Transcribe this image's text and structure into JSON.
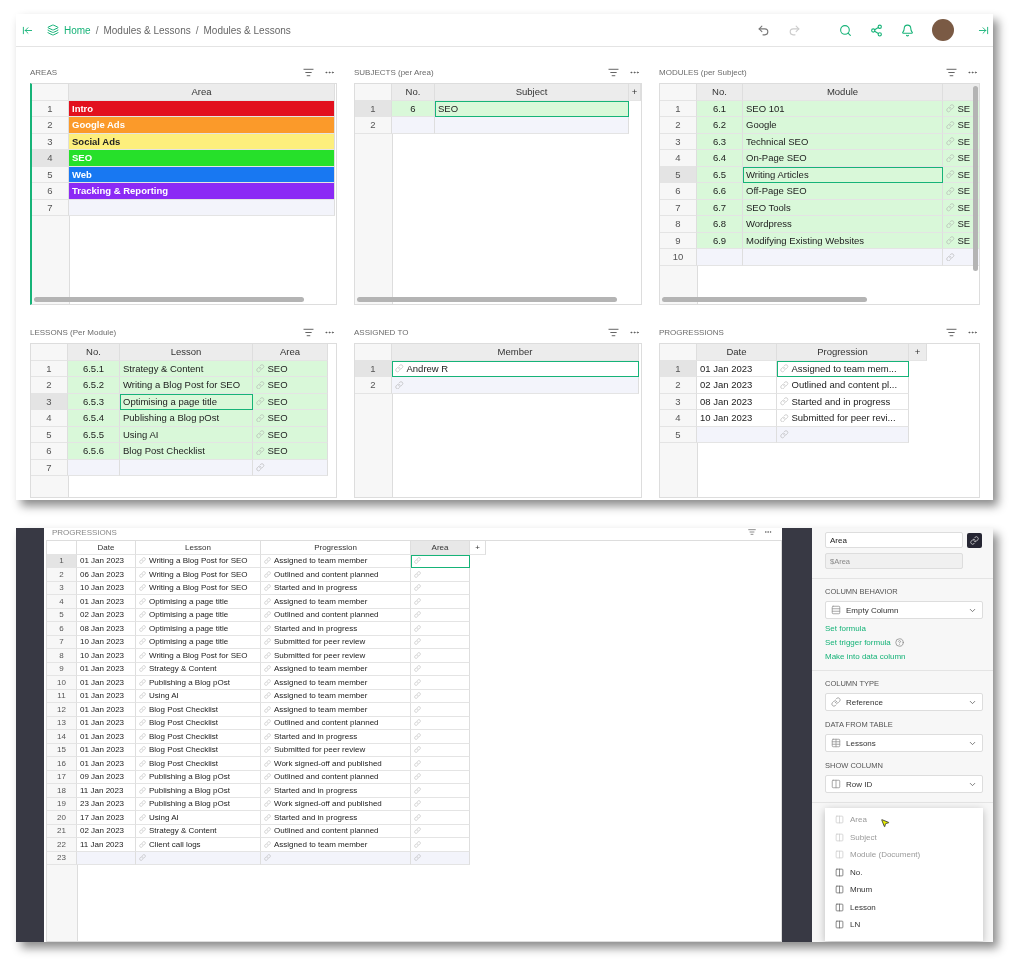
{
  "breadcrumb": {
    "items": [
      "Home",
      "Modules & Lessons",
      "Modules & Lessons"
    ],
    "separator": "/"
  },
  "widgets": [
    {
      "title": "AREAS",
      "active": true,
      "columns": [
        {
          "label": "Area",
          "kind": "text",
          "cursor": false
        }
      ],
      "rows": [
        {
          "num": "1",
          "cells": [
            "Intro"
          ],
          "color": "#e2101e",
          "selected": false
        },
        {
          "num": "2",
          "cells": [
            "Google Ads"
          ],
          "color": "#fb9a2a",
          "selected": false
        },
        {
          "num": "3",
          "cells": [
            "Social Ads"
          ],
          "color": "#fdef7c",
          "selected": false
        },
        {
          "num": "4",
          "cells": [
            "SEO"
          ],
          "color": "#26e02a",
          "selected": true
        },
        {
          "num": "5",
          "cells": [
            "Web"
          ],
          "color": "#1878f2",
          "selected": false
        },
        {
          "num": "6",
          "cells": [
            "Tracking & Reporting"
          ],
          "color": "#8b2af5",
          "selected": false
        }
      ],
      "new_row": "7"
    },
    {
      "title": "SUBJECTS (per Area)",
      "active": false,
      "add_label": "+",
      "columns": [
        {
          "label": "No.",
          "kind": "num",
          "cursor": false
        },
        {
          "label": "Subject",
          "kind": "text",
          "cursor": true
        }
      ],
      "rows": [
        {
          "num": "1",
          "cells": [
            "6",
            "SEO"
          ],
          "highlighted": true,
          "selected": true
        }
      ],
      "new_row": "2"
    },
    {
      "title": "MODULES (per Subject)",
      "active": false,
      "columns": [
        {
          "label": "No.",
          "kind": "num",
          "cursor": false
        },
        {
          "label": "Module",
          "kind": "text",
          "cursor": true
        },
        {
          "kind": "ref",
          "cursor": false
        }
      ],
      "rows": [
        {
          "num": "1",
          "cells": [
            "6.1",
            "SEO 101",
            "SE"
          ],
          "highlighted": true,
          "selected": false
        },
        {
          "num": "2",
          "cells": [
            "6.2",
            "Google",
            "SE"
          ],
          "highlighted": true,
          "selected": false
        },
        {
          "num": "3",
          "cells": [
            "6.3",
            "Technical SEO",
            "SE"
          ],
          "highlighted": true,
          "selected": false
        },
        {
          "num": "4",
          "cells": [
            "6.4",
            "On-Page SEO",
            "SE"
          ],
          "highlighted": true,
          "selected": false
        },
        {
          "num": "5",
          "cells": [
            "6.5",
            "Writing Articles",
            "SE"
          ],
          "highlighted": true,
          "selected": true
        },
        {
          "num": "6",
          "cells": [
            "6.6",
            "Off-Page SEO",
            "SE"
          ],
          "highlighted": true,
          "selected": false
        },
        {
          "num": "7",
          "cells": [
            "6.7",
            "SEO Tools",
            "SE"
          ],
          "highlighted": true,
          "selected": false
        },
        {
          "num": "8",
          "cells": [
            "6.8",
            "Wordpress",
            "SE"
          ],
          "highlighted": true,
          "selected": false
        },
        {
          "num": "9",
          "cells": [
            "6.9",
            "Modifying Existing Websites",
            "SE"
          ],
          "highlighted": true,
          "selected": false
        }
      ],
      "new_row": "10"
    },
    {
      "title": "LESSONS (Per Module)",
      "active": false,
      "columns": [
        {
          "label": "No.",
          "kind": "num",
          "cursor": false
        },
        {
          "label": "Lesson",
          "kind": "text",
          "cursor": true
        },
        {
          "label": "Area",
          "kind": "ref",
          "cursor": false
        }
      ],
      "rows": [
        {
          "num": "1",
          "cells": [
            "6.5.1",
            "Strategy & Content",
            "SEO"
          ],
          "highlighted": true,
          "selected": false
        },
        {
          "num": "2",
          "cells": [
            "6.5.2",
            "Writing a Blog Post for SEO",
            "SEO"
          ],
          "highlighted": true,
          "selected": false
        },
        {
          "num": "3",
          "cells": [
            "6.5.3",
            "Optimising a page title",
            "SEO"
          ],
          "highlighted": true,
          "selected": true
        },
        {
          "num": "4",
          "cells": [
            "6.5.4",
            "Publishing a Blog pOst",
            "SEO"
          ],
          "highlighted": true,
          "selected": false
        },
        {
          "num": "5",
          "cells": [
            "6.5.5",
            "Using AI",
            "SEO"
          ],
          "highlighted": true,
          "selected": false
        },
        {
          "num": "6",
          "cells": [
            "6.5.6",
            "Blog Post Checklist",
            "SEO"
          ],
          "highlighted": true,
          "selected": false
        }
      ],
      "new_row": "7"
    },
    {
      "title": "ASSIGNED TO",
      "active": false,
      "columns": [
        {
          "label": "Member",
          "kind": "ref",
          "cursor": true
        }
      ],
      "rows": [
        {
          "num": "1",
          "cells": [
            "Andrew R"
          ],
          "highlighted": false,
          "selected": true
        }
      ],
      "new_row": "2"
    },
    {
      "title": "PROGRESSIONS",
      "active": false,
      "add_label": "+",
      "columns": [
        {
          "label": "Date",
          "kind": "text",
          "cursor": false
        },
        {
          "label": "Progression",
          "kind": "ref",
          "cursor": true
        }
      ],
      "rows": [
        {
          "num": "1",
          "cells": [
            "01 Jan 2023",
            "Assigned to team mem..."
          ],
          "highlighted": false,
          "selected": true
        },
        {
          "num": "2",
          "cells": [
            "02 Jan 2023",
            "Outlined and content pl..."
          ],
          "highlighted": false,
          "selected": false
        },
        {
          "num": "3",
          "cells": [
            "08 Jan 2023",
            "Started and in progress"
          ],
          "highlighted": false,
          "selected": false
        },
        {
          "num": "4",
          "cells": [
            "10 Jan 2023",
            "Submitted for peer revi..."
          ],
          "highlighted": false,
          "selected": false
        }
      ],
      "new_row": "5"
    }
  ],
  "grid": {
    "title": "PROGRESSIONS",
    "add_label": "+",
    "columns": [
      {
        "label": "Date",
        "kind": "text",
        "selected": false,
        "cursor": false
      },
      {
        "label": "Lesson",
        "kind": "ref",
        "selected": false,
        "cursor": false
      },
      {
        "label": "Progression",
        "kind": "ref",
        "selected": false,
        "cursor": false
      },
      {
        "label": "Area",
        "kind": "ref",
        "selected": true,
        "cursor": true
      }
    ],
    "rows": [
      {
        "num": "1",
        "cells": [
          "01 Jan 2023",
          "Writing a Blog Post for SEO",
          "Assigned to team member",
          null
        ],
        "selected": true
      },
      {
        "num": "2",
        "cells": [
          "06 Jan 2023",
          "Writing a Blog Post for SEO",
          "Outlined and content planned",
          null
        ],
        "selected": false
      },
      {
        "num": "3",
        "cells": [
          "10 Jan 2023",
          "Writing a Blog Post for SEO",
          "Started and in progress",
          null
        ],
        "selected": false
      },
      {
        "num": "4",
        "cells": [
          "01 Jan 2023",
          "Optimising a page title",
          "Assigned to team member",
          null
        ],
        "selected": false
      },
      {
        "num": "5",
        "cells": [
          "02 Jan 2023",
          "Optimising a page title",
          "Outlined and content planned",
          null
        ],
        "selected": false
      },
      {
        "num": "6",
        "cells": [
          "08 Jan 2023",
          "Optimising a page title",
          "Started and in progress",
          null
        ],
        "selected": false
      },
      {
        "num": "7",
        "cells": [
          "10 Jan 2023",
          "Optimising a page title",
          "Submitted for peer review",
          null
        ],
        "selected": false
      },
      {
        "num": "8",
        "cells": [
          "10 Jan 2023",
          "Writing a Blog Post for SEO",
          "Submitted for peer review",
          null
        ],
        "selected": false
      },
      {
        "num": "9",
        "cells": [
          "01 Jan 2023",
          "Strategy & Content",
          "Assigned to team member",
          null
        ],
        "selected": false
      },
      {
        "num": "10",
        "cells": [
          "01 Jan 2023",
          "Publishing a Blog pOst",
          "Assigned to team member",
          null
        ],
        "selected": false
      },
      {
        "num": "11",
        "cells": [
          "01 Jan 2023",
          "Using AI",
          "Assigned to team member",
          null
        ],
        "selected": false
      },
      {
        "num": "12",
        "cells": [
          "01 Jan 2023",
          "Blog Post Checklist",
          "Assigned to team member",
          null
        ],
        "selected": false
      },
      {
        "num": "13",
        "cells": [
          "01 Jan 2023",
          "Blog Post Checklist",
          "Outlined and content planned",
          null
        ],
        "selected": false
      },
      {
        "num": "14",
        "cells": [
          "01 Jan 2023",
          "Blog Post Checklist",
          "Started and in progress",
          null
        ],
        "selected": false
      },
      {
        "num": "15",
        "cells": [
          "01 Jan 2023",
          "Blog Post Checklist",
          "Submitted for peer review",
          null
        ],
        "selected": false
      },
      {
        "num": "16",
        "cells": [
          "01 Jan 2023",
          "Blog Post Checklist",
          "Work signed-off and published",
          null
        ],
        "selected": false
      },
      {
        "num": "17",
        "cells": [
          "09 Jan 2023",
          "Publishing a Blog pOst",
          "Outlined and content planned",
          null
        ],
        "selected": false
      },
      {
        "num": "18",
        "cells": [
          "11 Jan 2023",
          "Publishing a Blog pOst",
          "Started and in progress",
          null
        ],
        "selected": false
      },
      {
        "num": "19",
        "cells": [
          "23 Jan 2023",
          "Publishing a Blog pOst",
          "Work signed-off and published",
          null
        ],
        "selected": false
      },
      {
        "num": "20",
        "cells": [
          "17 Jan 2023",
          "Using AI",
          "Started and in progress",
          null
        ],
        "selected": false
      },
      {
        "num": "21",
        "cells": [
          "02 Jan 2023",
          "Strategy & Content",
          "Outlined and content planned",
          null
        ],
        "selected": false
      },
      {
        "num": "22",
        "cells": [
          "11 Jan 2023",
          "Client call logs",
          "Assigned to team member",
          null
        ],
        "selected": false
      }
    ],
    "new_row": "23"
  },
  "side_panel": {
    "label": "Area",
    "col_id": "$Area",
    "behavior": {
      "title": "COLUMN BEHAVIOR",
      "value": "Empty Column",
      "kind": "rows"
    },
    "actions": [
      {
        "label": "Set formula"
      },
      {
        "label": "Set trigger formula",
        "help": true
      },
      {
        "label": "Make into data column"
      }
    ],
    "selects": [
      {
        "title": "COLUMN TYPE",
        "value": "Reference",
        "kind": "link"
      },
      {
        "title": "DATA FROM TABLE",
        "value": "Lessons",
        "kind": "table"
      },
      {
        "title": "SHOW COLUMN",
        "value": "Row ID",
        "kind": "column"
      }
    ],
    "menu": [
      {
        "label": "Area",
        "disabled": true
      },
      {
        "label": "Subject",
        "disabled": true
      },
      {
        "label": "Module (Document)",
        "disabled": true
      },
      {
        "label": "No.",
        "disabled": false
      },
      {
        "label": "Mnum",
        "disabled": false
      },
      {
        "label": "Lesson",
        "disabled": false
      },
      {
        "label": "LN",
        "disabled": false
      }
    ]
  }
}
